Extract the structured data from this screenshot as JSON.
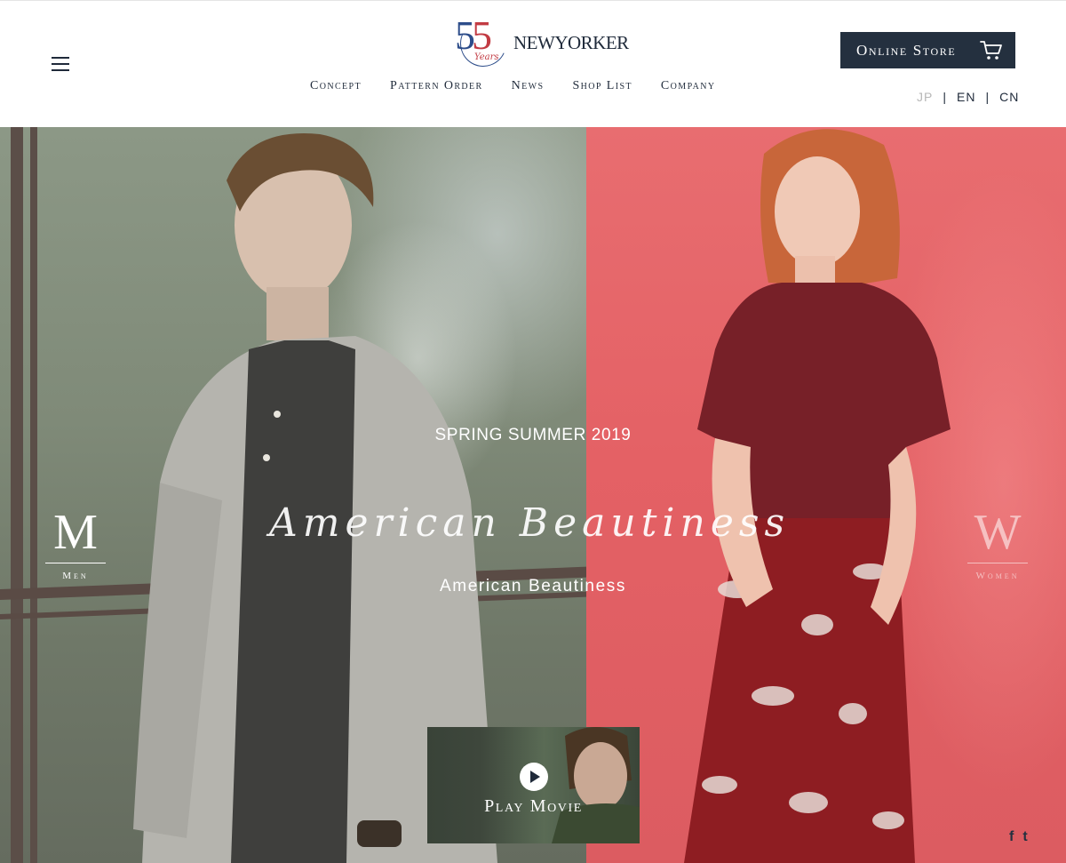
{
  "brand": {
    "logo_number": "55",
    "logo_years": "Years",
    "logo_wordmark": "NEWYORKER",
    "colors": {
      "navy": "#2d4d8a",
      "red": "#c23b43",
      "dark": "#1f2a3a"
    }
  },
  "header": {
    "menu_icon": "hamburger-icon",
    "nav": [
      {
        "label": "Concept"
      },
      {
        "label": "Pattern Order"
      },
      {
        "label": "News"
      },
      {
        "label": "Shop List"
      },
      {
        "label": "Company"
      }
    ],
    "online_store": {
      "label": "Online Store",
      "icon": "cart-icon",
      "bg": "#24303f"
    },
    "languages": [
      {
        "label": "JP",
        "active": true
      },
      {
        "label": "EN",
        "active": false
      },
      {
        "label": "CN",
        "active": false
      }
    ]
  },
  "hero": {
    "season": "SPRING SUMMER 2019",
    "script_title": "American Beautiness",
    "subtitle": "American Beautiness",
    "men": {
      "letter": "M",
      "label": "Men"
    },
    "women": {
      "letter": "W",
      "label": "Women"
    },
    "movie": {
      "label": "Play Movie",
      "icon": "play-icon"
    }
  },
  "social": [
    {
      "label": "f",
      "icon": "facebook-icon"
    },
    {
      "label": "t",
      "icon": "twitter-icon"
    }
  ]
}
